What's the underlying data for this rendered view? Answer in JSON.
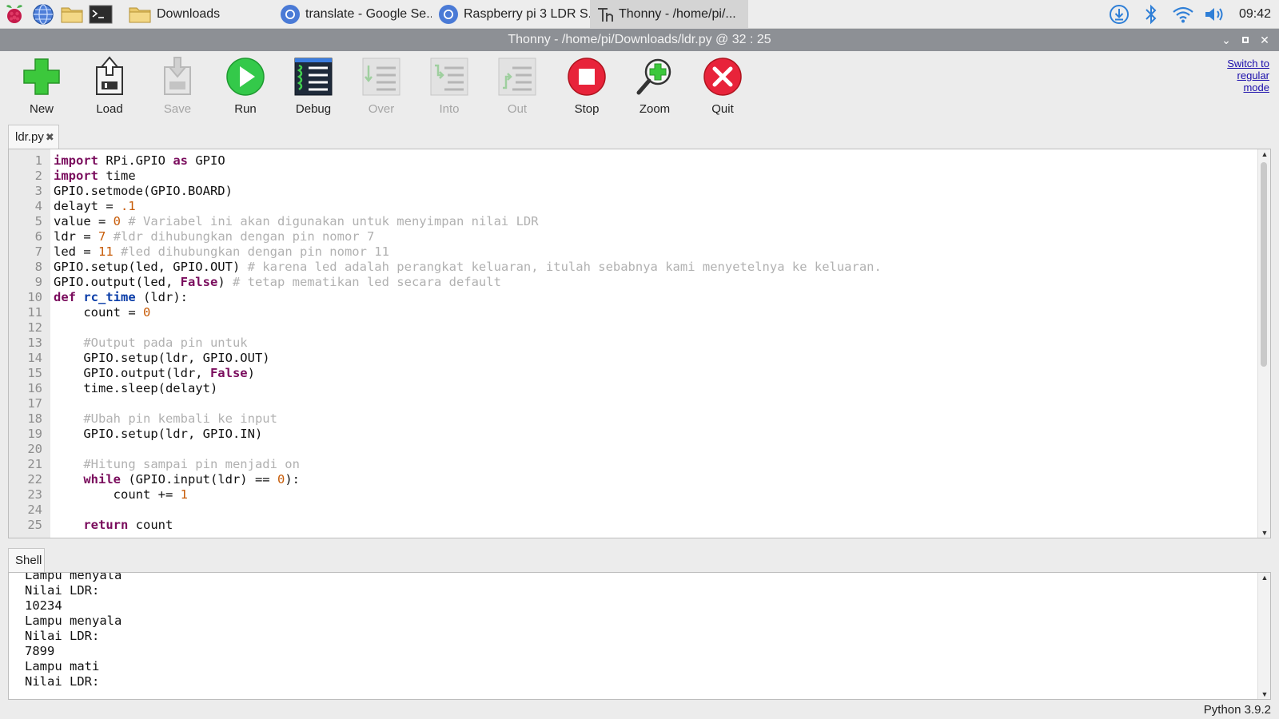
{
  "taskbar": {
    "tasks": [
      {
        "label": "Downloads"
      },
      {
        "label": "translate - Google Se..."
      },
      {
        "label": "Raspberry pi 3 LDR S..."
      },
      {
        "label": "Thonny  -  /home/pi/..."
      }
    ],
    "clock": "09:42"
  },
  "window": {
    "title": "Thonny  -  /home/pi/Downloads/ldr.py  @  32 : 25"
  },
  "toolbar": {
    "new": "New",
    "load": "Load",
    "save": "Save",
    "run": "Run",
    "debug": "Debug",
    "over": "Over",
    "into": "Into",
    "out": "Out",
    "stop": "Stop",
    "zoom": "Zoom",
    "quit": "Quit",
    "switch_mode": "Switch to regular mode"
  },
  "editor": {
    "tab_label": "ldr.py",
    "line_numbers": [
      "1",
      "2",
      "3",
      "4",
      "5",
      "6",
      "7",
      "8",
      "9",
      "10",
      "11",
      "12",
      "13",
      "14",
      "15",
      "16",
      "17",
      "18",
      "19",
      "20",
      "21",
      "22",
      "23",
      "24",
      "25"
    ],
    "code_lines": [
      "import RPi.GPIO as GPIO",
      "import time",
      "GPIO.setmode(GPIO.BOARD)",
      "delayt = .1",
      "value = 0 # Variabel ini akan digunakan untuk menyimpan nilai LDR",
      "ldr = 7 #ldr dihubungkan dengan pin nomor 7",
      "led = 11 #led dihubungkan dengan pin nomor 11",
      "GPIO.setup(led, GPIO.OUT) # karena led adalah perangkat keluaran, itulah sebabnya kami menyetelnya ke keluaran.",
      "GPIO.output(led, False) # tetap mematikan led secara default",
      "def rc_time (ldr):",
      "    count = 0",
      "",
      "    #Output pada pin untuk",
      "    GPIO.setup(ldr, GPIO.OUT)",
      "    GPIO.output(ldr, False)",
      "    time.sleep(delayt)",
      "",
      "    #Ubah pin kembali ke input",
      "    GPIO.setup(ldr, GPIO.IN)",
      "",
      "    #Hitung sampai pin menjadi on",
      "    while (GPIO.input(ldr) == 0):",
      "        count += 1",
      "",
      "    return count"
    ]
  },
  "shell": {
    "tab_label": "Shell",
    "lines": [
      "Lampu menyala",
      "Nilai LDR:",
      "10234",
      "Lampu menyala",
      "Nilai LDR:",
      "7899",
      "Lampu mati",
      "Nilai LDR:"
    ]
  },
  "status": {
    "python_version": "Python 3.9.2"
  },
  "colors": {
    "keyword": "#7a0c5d",
    "function_name": "#0a3da8",
    "number": "#c75b07",
    "comment": "#b1b1b1",
    "title_bar": "#8d9095"
  }
}
